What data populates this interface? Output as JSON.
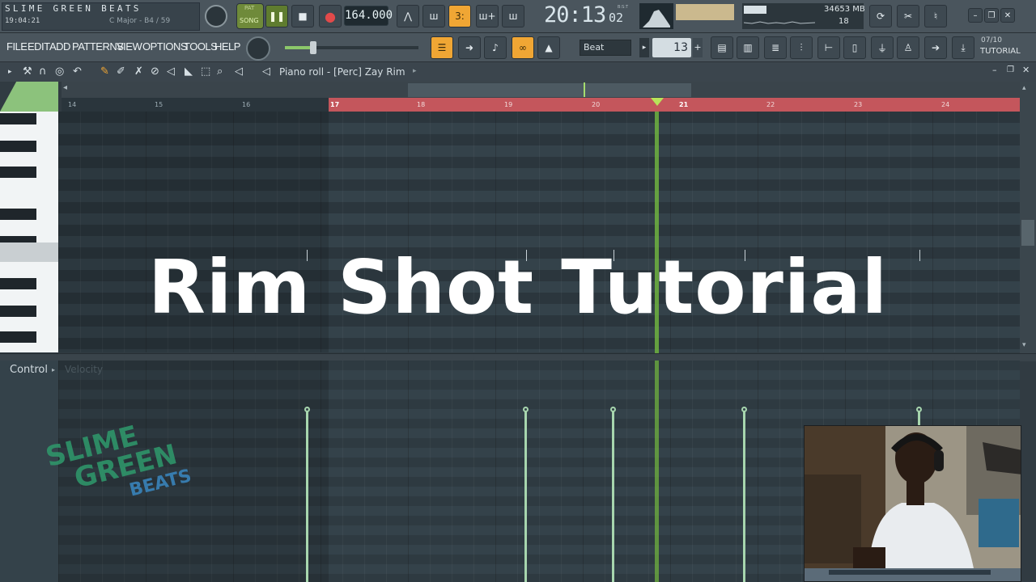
{
  "transport": {
    "project_title": "SLIME GREEN BEATS",
    "time_readout": "19:04:21",
    "key_readout": "C Major - B4 / 59",
    "song_label": "SONG",
    "pat_label": "PAT",
    "tempo": "164.000",
    "clock": "20:13",
    "clock_ms": "02",
    "clock_unit": "B:S:T",
    "cpu": "34",
    "memory": "653 MB",
    "polyphony": "18"
  },
  "menu": {
    "items": [
      "FILE",
      "EDIT",
      "ADD",
      "PATTERNS",
      "VIEW",
      "OPTIONS",
      "TOOLS",
      "HELP"
    ]
  },
  "toolbar": {
    "snap_value": "Beat",
    "step_value": "13",
    "hint_count": "07/10",
    "hint_label": "TUTORIAL"
  },
  "piano_roll": {
    "title": "Piano roll - [Perc] Zay Rim",
    "bar_numbers": [
      "14",
      "15",
      "16",
      "17",
      "18",
      "19",
      "20",
      "21",
      "22",
      "23",
      "24"
    ],
    "control_label": "Control",
    "control_sub": "Velocity"
  },
  "overlay": {
    "title": "Rim Shot Tutorial"
  },
  "watermark": {
    "line1": "SLIME",
    "line2": "GREEN",
    "line3": "BEATS"
  },
  "colors": {
    "accent_orange": "#f0a634",
    "playhead_green": "#6fb23f",
    "loop_red": "#c4565c",
    "velocity_green": "#a7d6ae"
  }
}
